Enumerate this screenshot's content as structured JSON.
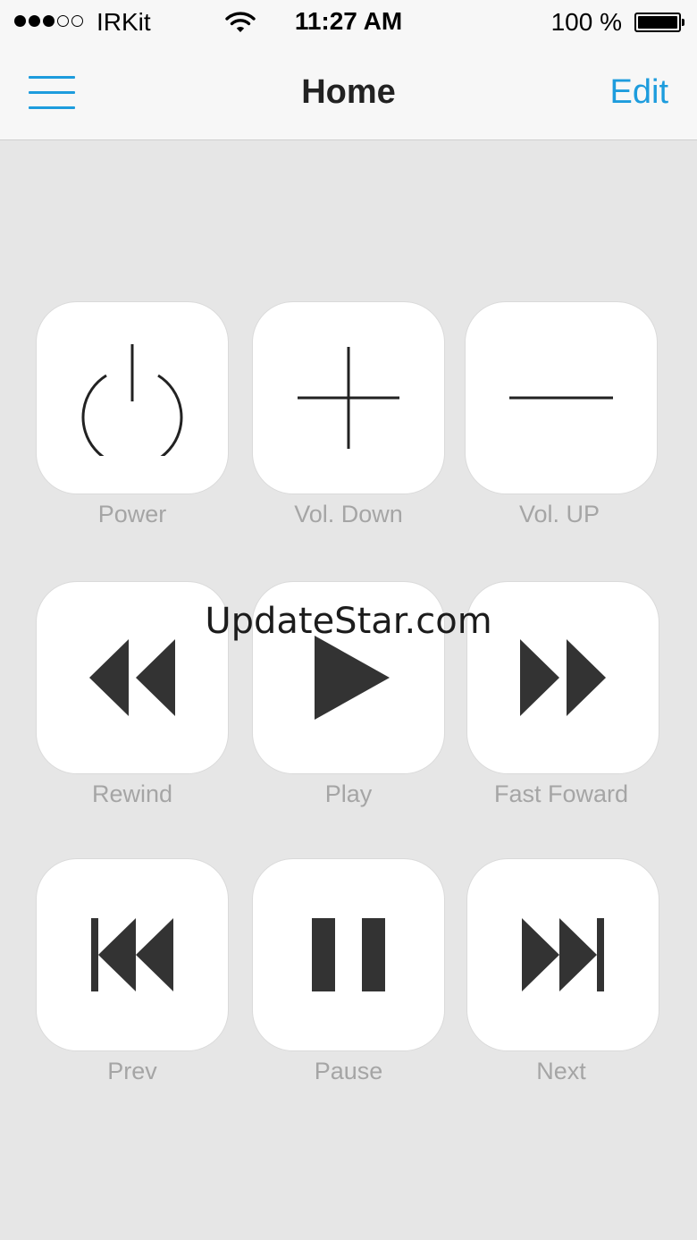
{
  "status_bar": {
    "carrier": "IRKit",
    "time": "11:27 AM",
    "battery_percent": "100 %",
    "battery_level": 1.0,
    "signal_bars": 3,
    "signal_total": 5
  },
  "nav": {
    "title": "Home",
    "edit_label": "Edit",
    "menu_icon": "hamburger-menu-icon",
    "accent_color": "#1d9cdd"
  },
  "buttons": [
    {
      "label": "Power",
      "icon": "power-icon"
    },
    {
      "label": "Vol. Down",
      "icon": "plus-icon"
    },
    {
      "label": "Vol. UP",
      "icon": "minus-icon"
    },
    {
      "label": "Rewind",
      "icon": "rewind-icon"
    },
    {
      "label": "Play",
      "icon": "play-icon"
    },
    {
      "label": "Fast Foward",
      "icon": "fast-forward-icon"
    },
    {
      "label": "Prev",
      "icon": "skip-previous-icon"
    },
    {
      "label": "Pause",
      "icon": "pause-icon"
    },
    {
      "label": "Next",
      "icon": "skip-next-icon"
    }
  ],
  "watermark": "UpdateStar.com"
}
